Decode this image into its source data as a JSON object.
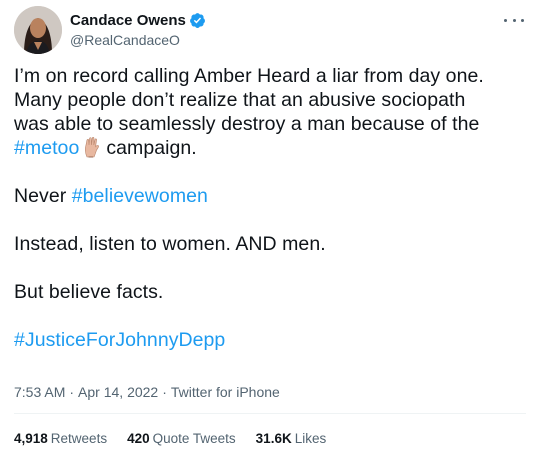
{
  "author": {
    "display_name": "Candace Owens",
    "handle": "@RealCandaceO",
    "verified": true,
    "avatar_icon": "profile-photo",
    "more_icon": "more-options-icon"
  },
  "tweet": {
    "line1": "I’m on record calling Amber Heard a liar from day one.",
    "line2": "Many people don’t realize that an abusive sociopath",
    "line3": "was able to seamlessly destroy a man because of the",
    "hashtag_metoo": "#metoo",
    "emoji": "raised-hand-emoji",
    "line4_after": "campaign.",
    "never_text": "Never",
    "hashtag_believewomen": "#believewomen",
    "listen_text": "Instead, listen to women. AND men.",
    "facts_text": "But believe facts.",
    "hashtag_justice": "#JusticeForJohnnyDepp"
  },
  "meta": {
    "time": "7:53 AM",
    "separator": "·",
    "date": "Apr 14, 2022",
    "source": "Twitter for iPhone"
  },
  "stats": {
    "retweets_count": "4,918",
    "retweets_label": "Retweets",
    "quotes_count": "420",
    "quotes_label": "Quote Tweets",
    "likes_count": "31.6K",
    "likes_label": "Likes"
  },
  "colors": {
    "link": "#1d9bf0",
    "text": "#0f1419",
    "secondary": "#536471"
  }
}
